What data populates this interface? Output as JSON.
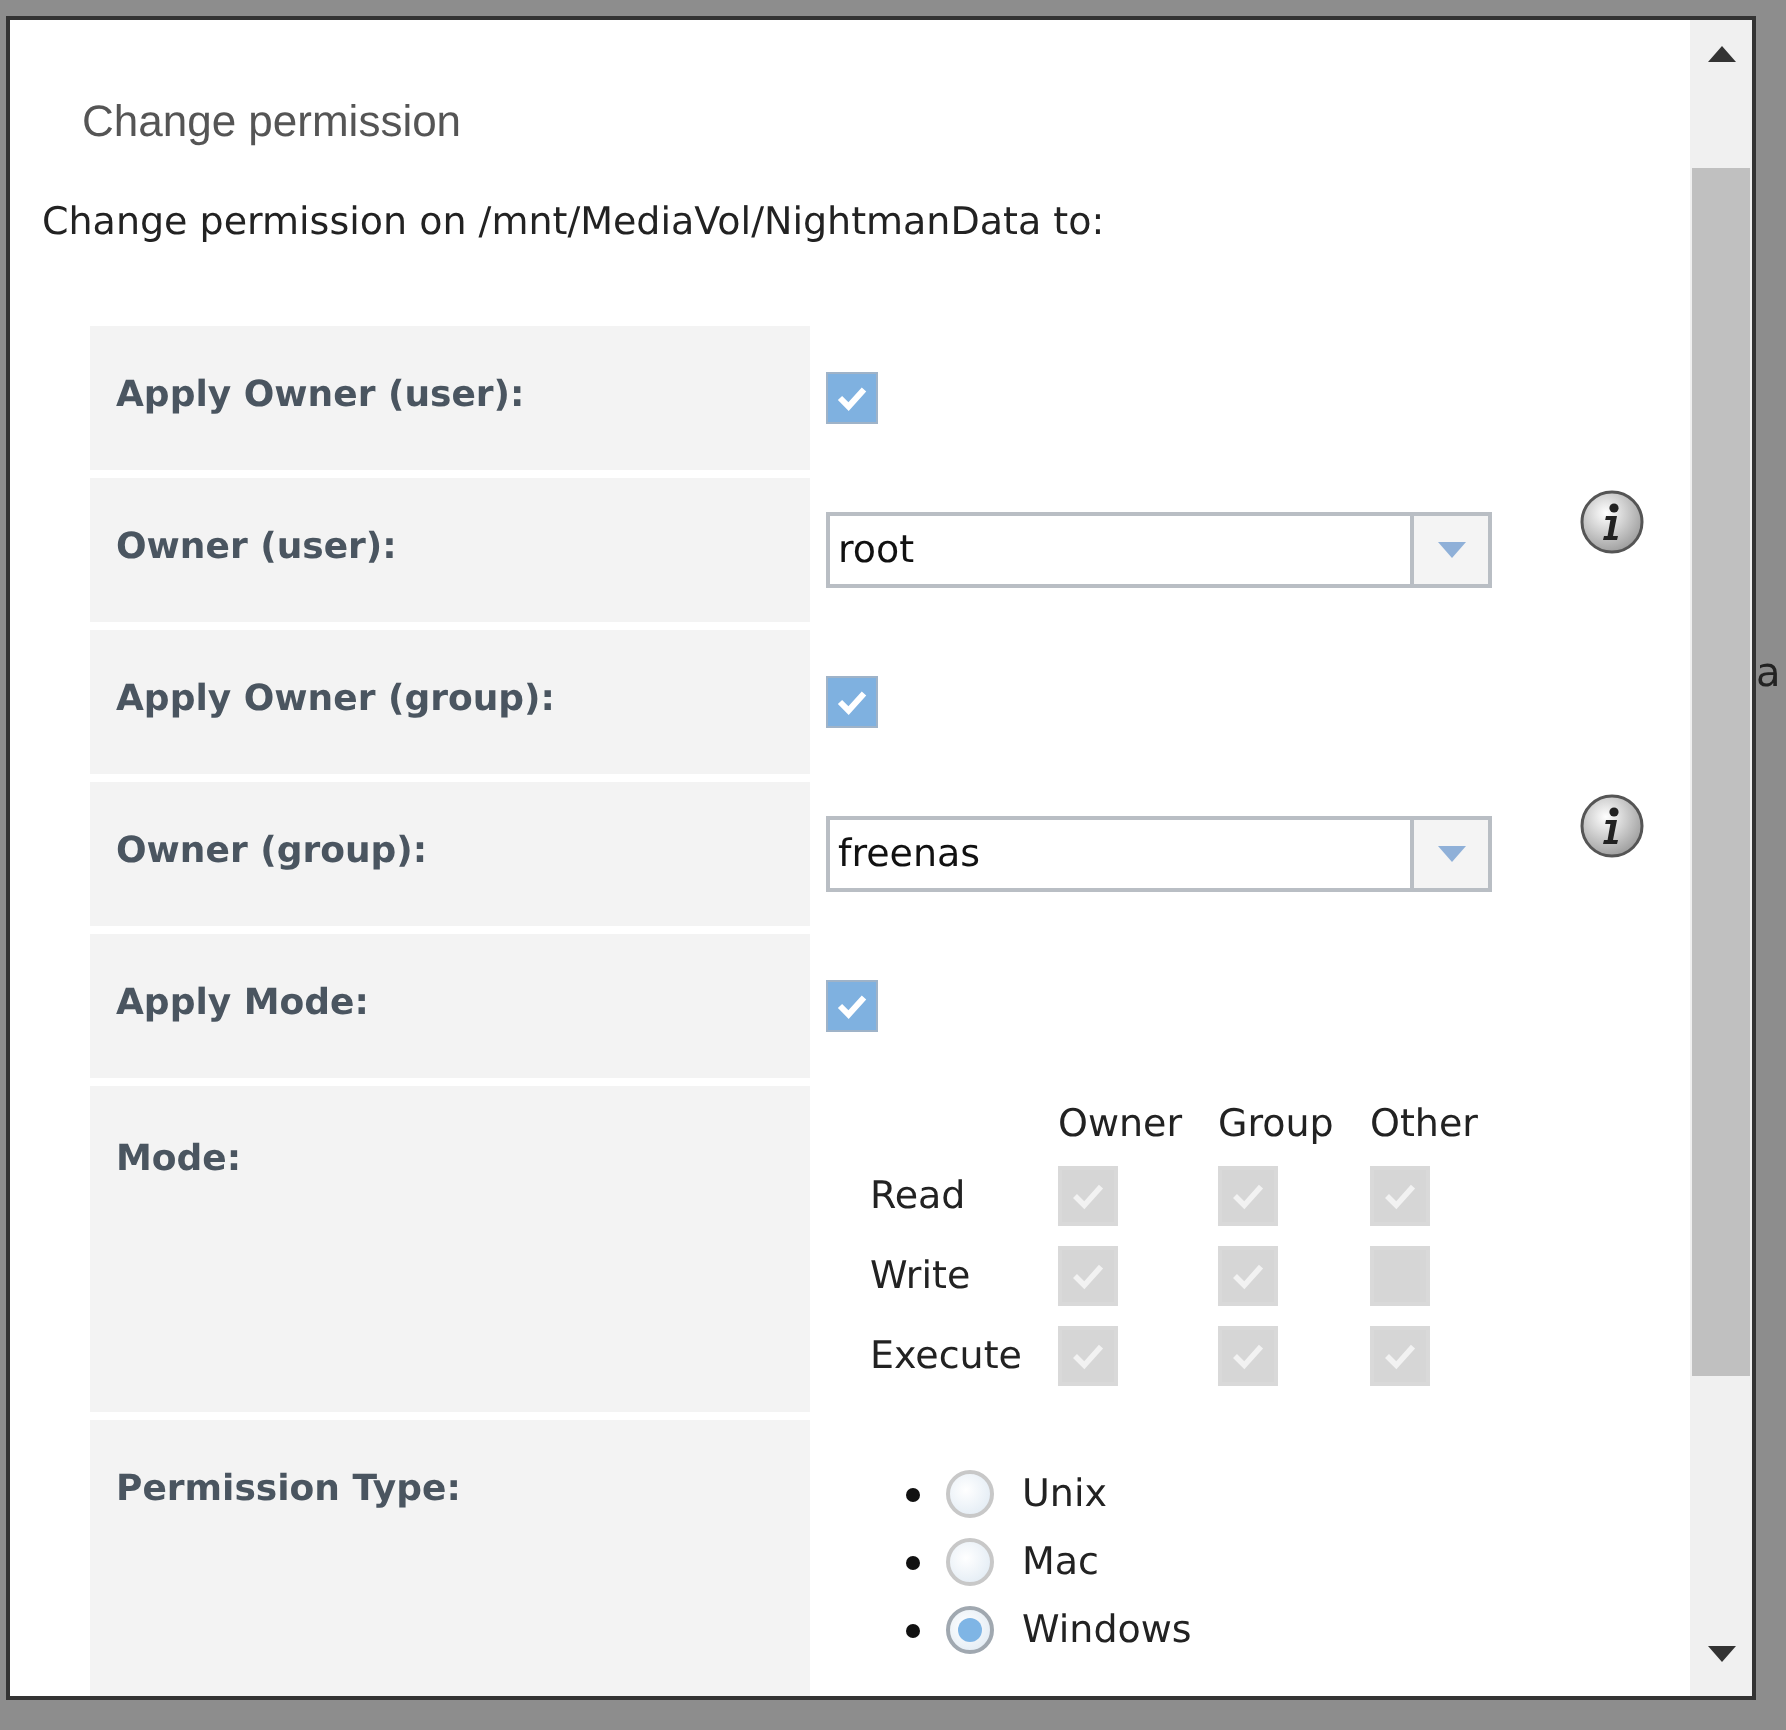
{
  "dialog": {
    "title": "Change permission",
    "intro": "Change permission on /mnt/MediaVol/NightmanData to:",
    "fields": [
      {
        "kind": "checkbox",
        "label": "Apply Owner (user):",
        "checked": true
      },
      {
        "kind": "select",
        "label": "Owner (user):",
        "value": "root"
      },
      {
        "kind": "checkbox",
        "label": "Apply Owner (group):",
        "checked": true
      },
      {
        "kind": "select",
        "label": "Owner (group):",
        "value": "freenas"
      },
      {
        "kind": "checkbox",
        "label": "Apply Mode:",
        "checked": true
      },
      {
        "kind": "mode",
        "label": "Mode:",
        "disabled": true,
        "columns": [
          "Owner",
          "Group",
          "Other"
        ],
        "rows": [
          {
            "label": "Read",
            "bits": [
              {
                "checked": true
              },
              {
                "checked": true
              },
              {
                "checked": true
              }
            ]
          },
          {
            "label": "Write",
            "bits": [
              {
                "checked": true
              },
              {
                "checked": true
              },
              {
                "checked": false
              }
            ]
          },
          {
            "label": "Execute",
            "bits": [
              {
                "checked": true
              },
              {
                "checked": true
              },
              {
                "checked": true
              }
            ]
          }
        ]
      },
      {
        "kind": "radio",
        "label": "Permission Type:",
        "options": [
          {
            "label": "Unix",
            "selected": false
          },
          {
            "label": "Mac",
            "selected": false
          },
          {
            "label": "Windows",
            "selected": true
          }
        ]
      }
    ]
  },
  "background_text": "a"
}
